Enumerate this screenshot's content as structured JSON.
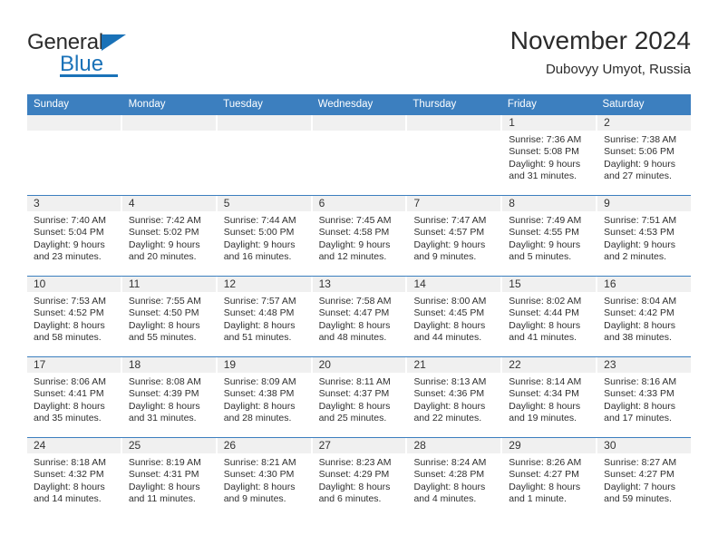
{
  "brand": {
    "name_top": "General",
    "name_bottom": "Blue",
    "accent_color": "#1a72b8"
  },
  "header": {
    "title": "November 2024",
    "location": "Dubovyy Umyot, Russia"
  },
  "theme": {
    "header_blue": "#3c7fbf",
    "day_band": "#f0f0f0",
    "text": "#2f2f2f"
  },
  "weekdays": [
    "Sunday",
    "Monday",
    "Tuesday",
    "Wednesday",
    "Thursday",
    "Friday",
    "Saturday"
  ],
  "weeks": [
    [
      {
        "day": "",
        "sunrise": "",
        "sunset": "",
        "daylight_line1": "",
        "daylight_line2": ""
      },
      {
        "day": "",
        "sunrise": "",
        "sunset": "",
        "daylight_line1": "",
        "daylight_line2": ""
      },
      {
        "day": "",
        "sunrise": "",
        "sunset": "",
        "daylight_line1": "",
        "daylight_line2": ""
      },
      {
        "day": "",
        "sunrise": "",
        "sunset": "",
        "daylight_line1": "",
        "daylight_line2": ""
      },
      {
        "day": "",
        "sunrise": "",
        "sunset": "",
        "daylight_line1": "",
        "daylight_line2": ""
      },
      {
        "day": "1",
        "sunrise": "Sunrise: 7:36 AM",
        "sunset": "Sunset: 5:08 PM",
        "daylight_line1": "Daylight: 9 hours",
        "daylight_line2": "and 31 minutes."
      },
      {
        "day": "2",
        "sunrise": "Sunrise: 7:38 AM",
        "sunset": "Sunset: 5:06 PM",
        "daylight_line1": "Daylight: 9 hours",
        "daylight_line2": "and 27 minutes."
      }
    ],
    [
      {
        "day": "3",
        "sunrise": "Sunrise: 7:40 AM",
        "sunset": "Sunset: 5:04 PM",
        "daylight_line1": "Daylight: 9 hours",
        "daylight_line2": "and 23 minutes."
      },
      {
        "day": "4",
        "sunrise": "Sunrise: 7:42 AM",
        "sunset": "Sunset: 5:02 PM",
        "daylight_line1": "Daylight: 9 hours",
        "daylight_line2": "and 20 minutes."
      },
      {
        "day": "5",
        "sunrise": "Sunrise: 7:44 AM",
        "sunset": "Sunset: 5:00 PM",
        "daylight_line1": "Daylight: 9 hours",
        "daylight_line2": "and 16 minutes."
      },
      {
        "day": "6",
        "sunrise": "Sunrise: 7:45 AM",
        "sunset": "Sunset: 4:58 PM",
        "daylight_line1": "Daylight: 9 hours",
        "daylight_line2": "and 12 minutes."
      },
      {
        "day": "7",
        "sunrise": "Sunrise: 7:47 AM",
        "sunset": "Sunset: 4:57 PM",
        "daylight_line1": "Daylight: 9 hours",
        "daylight_line2": "and 9 minutes."
      },
      {
        "day": "8",
        "sunrise": "Sunrise: 7:49 AM",
        "sunset": "Sunset: 4:55 PM",
        "daylight_line1": "Daylight: 9 hours",
        "daylight_line2": "and 5 minutes."
      },
      {
        "day": "9",
        "sunrise": "Sunrise: 7:51 AM",
        "sunset": "Sunset: 4:53 PM",
        "daylight_line1": "Daylight: 9 hours",
        "daylight_line2": "and 2 minutes."
      }
    ],
    [
      {
        "day": "10",
        "sunrise": "Sunrise: 7:53 AM",
        "sunset": "Sunset: 4:52 PM",
        "daylight_line1": "Daylight: 8 hours",
        "daylight_line2": "and 58 minutes."
      },
      {
        "day": "11",
        "sunrise": "Sunrise: 7:55 AM",
        "sunset": "Sunset: 4:50 PM",
        "daylight_line1": "Daylight: 8 hours",
        "daylight_line2": "and 55 minutes."
      },
      {
        "day": "12",
        "sunrise": "Sunrise: 7:57 AM",
        "sunset": "Sunset: 4:48 PM",
        "daylight_line1": "Daylight: 8 hours",
        "daylight_line2": "and 51 minutes."
      },
      {
        "day": "13",
        "sunrise": "Sunrise: 7:58 AM",
        "sunset": "Sunset: 4:47 PM",
        "daylight_line1": "Daylight: 8 hours",
        "daylight_line2": "and 48 minutes."
      },
      {
        "day": "14",
        "sunrise": "Sunrise: 8:00 AM",
        "sunset": "Sunset: 4:45 PM",
        "daylight_line1": "Daylight: 8 hours",
        "daylight_line2": "and 44 minutes."
      },
      {
        "day": "15",
        "sunrise": "Sunrise: 8:02 AM",
        "sunset": "Sunset: 4:44 PM",
        "daylight_line1": "Daylight: 8 hours",
        "daylight_line2": "and 41 minutes."
      },
      {
        "day": "16",
        "sunrise": "Sunrise: 8:04 AM",
        "sunset": "Sunset: 4:42 PM",
        "daylight_line1": "Daylight: 8 hours",
        "daylight_line2": "and 38 minutes."
      }
    ],
    [
      {
        "day": "17",
        "sunrise": "Sunrise: 8:06 AM",
        "sunset": "Sunset: 4:41 PM",
        "daylight_line1": "Daylight: 8 hours",
        "daylight_line2": "and 35 minutes."
      },
      {
        "day": "18",
        "sunrise": "Sunrise: 8:08 AM",
        "sunset": "Sunset: 4:39 PM",
        "daylight_line1": "Daylight: 8 hours",
        "daylight_line2": "and 31 minutes."
      },
      {
        "day": "19",
        "sunrise": "Sunrise: 8:09 AM",
        "sunset": "Sunset: 4:38 PM",
        "daylight_line1": "Daylight: 8 hours",
        "daylight_line2": "and 28 minutes."
      },
      {
        "day": "20",
        "sunrise": "Sunrise: 8:11 AM",
        "sunset": "Sunset: 4:37 PM",
        "daylight_line1": "Daylight: 8 hours",
        "daylight_line2": "and 25 minutes."
      },
      {
        "day": "21",
        "sunrise": "Sunrise: 8:13 AM",
        "sunset": "Sunset: 4:36 PM",
        "daylight_line1": "Daylight: 8 hours",
        "daylight_line2": "and 22 minutes."
      },
      {
        "day": "22",
        "sunrise": "Sunrise: 8:14 AM",
        "sunset": "Sunset: 4:34 PM",
        "daylight_line1": "Daylight: 8 hours",
        "daylight_line2": "and 19 minutes."
      },
      {
        "day": "23",
        "sunrise": "Sunrise: 8:16 AM",
        "sunset": "Sunset: 4:33 PM",
        "daylight_line1": "Daylight: 8 hours",
        "daylight_line2": "and 17 minutes."
      }
    ],
    [
      {
        "day": "24",
        "sunrise": "Sunrise: 8:18 AM",
        "sunset": "Sunset: 4:32 PM",
        "daylight_line1": "Daylight: 8 hours",
        "daylight_line2": "and 14 minutes."
      },
      {
        "day": "25",
        "sunrise": "Sunrise: 8:19 AM",
        "sunset": "Sunset: 4:31 PM",
        "daylight_line1": "Daylight: 8 hours",
        "daylight_line2": "and 11 minutes."
      },
      {
        "day": "26",
        "sunrise": "Sunrise: 8:21 AM",
        "sunset": "Sunset: 4:30 PM",
        "daylight_line1": "Daylight: 8 hours",
        "daylight_line2": "and 9 minutes."
      },
      {
        "day": "27",
        "sunrise": "Sunrise: 8:23 AM",
        "sunset": "Sunset: 4:29 PM",
        "daylight_line1": "Daylight: 8 hours",
        "daylight_line2": "and 6 minutes."
      },
      {
        "day": "28",
        "sunrise": "Sunrise: 8:24 AM",
        "sunset": "Sunset: 4:28 PM",
        "daylight_line1": "Daylight: 8 hours",
        "daylight_line2": "and 4 minutes."
      },
      {
        "day": "29",
        "sunrise": "Sunrise: 8:26 AM",
        "sunset": "Sunset: 4:27 PM",
        "daylight_line1": "Daylight: 8 hours",
        "daylight_line2": "and 1 minute."
      },
      {
        "day": "30",
        "sunrise": "Sunrise: 8:27 AM",
        "sunset": "Sunset: 4:27 PM",
        "daylight_line1": "Daylight: 7 hours",
        "daylight_line2": "and 59 minutes."
      }
    ]
  ]
}
